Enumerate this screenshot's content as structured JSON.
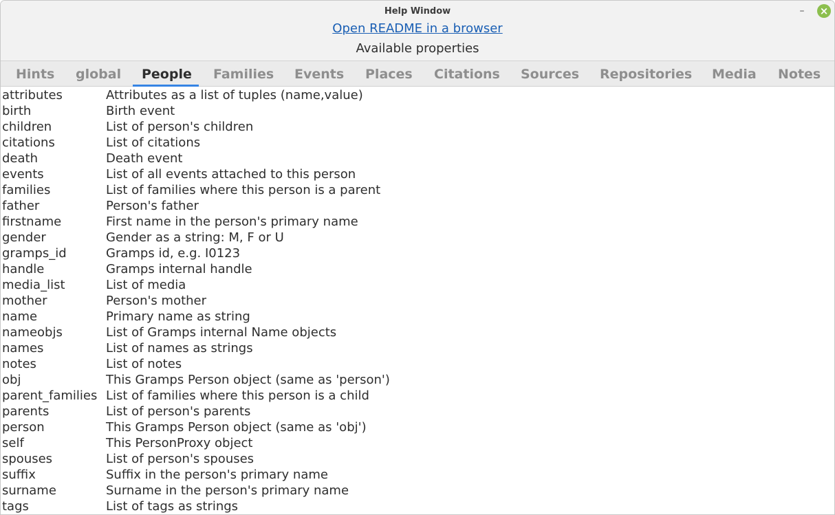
{
  "window": {
    "title": "Help Window"
  },
  "header": {
    "readme_link": "Open README in a browser",
    "available_label": "Available properties"
  },
  "tabs": [
    "Hints",
    "global",
    "People",
    "Families",
    "Events",
    "Places",
    "Citations",
    "Sources",
    "Repositories",
    "Media",
    "Notes"
  ],
  "active_tab": "People",
  "properties": [
    {
      "name": "attributes",
      "description": "Attributes as a list of tuples (name,value)"
    },
    {
      "name": "birth",
      "description": "Birth event"
    },
    {
      "name": "children",
      "description": "List of person's children"
    },
    {
      "name": "citations",
      "description": "List of citations"
    },
    {
      "name": "death",
      "description": "Death event"
    },
    {
      "name": "events",
      "description": "List of all events attached to this person"
    },
    {
      "name": "families",
      "description": "List of families where this person is a parent"
    },
    {
      "name": "father",
      "description": "Person's father"
    },
    {
      "name": "firstname",
      "description": "First name in the person's primary name"
    },
    {
      "name": "gender",
      "description": "Gender as a string: M, F or U"
    },
    {
      "name": "gramps_id",
      "description": "Gramps id, e.g. I0123"
    },
    {
      "name": "handle",
      "description": "Gramps internal handle"
    },
    {
      "name": "media_list",
      "description": "List of media"
    },
    {
      "name": "mother",
      "description": "Person's mother"
    },
    {
      "name": "name",
      "description": "Primary name as string"
    },
    {
      "name": "nameobjs",
      "description": "List of Gramps internal Name objects"
    },
    {
      "name": "names",
      "description": "List of names as strings"
    },
    {
      "name": "notes",
      "description": "List of notes"
    },
    {
      "name": "obj",
      "description": "This Gramps Person object (same as 'person')"
    },
    {
      "name": "parent_families",
      "description": "List of families where this person is a child"
    },
    {
      "name": "parents",
      "description": "List of person's parents"
    },
    {
      "name": "person",
      "description": "This Gramps Person object (same as 'obj')"
    },
    {
      "name": "self",
      "description": "This PersonProxy object"
    },
    {
      "name": "spouses",
      "description": "List of person's spouses"
    },
    {
      "name": "suffix",
      "description": "Suffix in the person's primary name"
    },
    {
      "name": "surname",
      "description": "Surname in the person's primary name"
    },
    {
      "name": "tags",
      "description": "List of tags as strings"
    }
  ]
}
